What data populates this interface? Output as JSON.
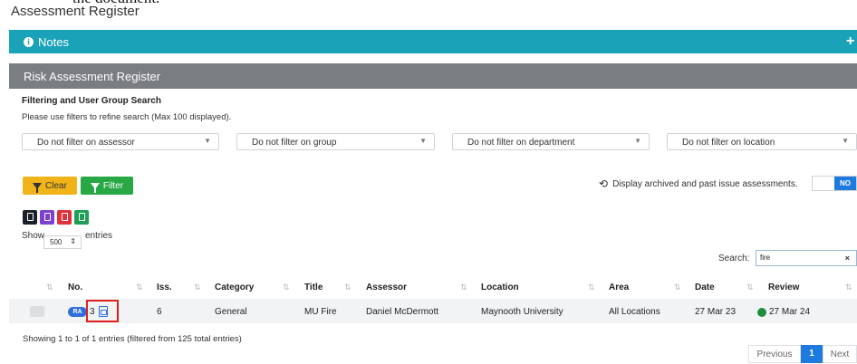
{
  "page": {
    "top_fragment": "the document.",
    "title": "Assessment Register"
  },
  "notes": {
    "label": "Notes"
  },
  "register": {
    "title": "Risk Assessment Register",
    "filter_heading": "Filtering and User Group Search",
    "filter_hint": "Please use filters to refine search (Max 100 displayed).",
    "filters": [
      {
        "label": "Do not filter on assessor"
      },
      {
        "label": "Do not filter on group"
      },
      {
        "label": "Do not filter on department"
      },
      {
        "label": "Do not filter on location"
      }
    ],
    "clear_label": "Clear",
    "filter_label": "Filter",
    "archive_text": "Display archived and past issue assessments.",
    "archive_toggle": "NO",
    "export_colors": [
      "#1c1f2b",
      "#7b3fd1",
      "#e0323a",
      "#1e9e57"
    ]
  },
  "table_controls": {
    "show_label": "Show",
    "length_value": "500",
    "entries_label": "entries",
    "search_label": "Search:",
    "search_value": "fire"
  },
  "table": {
    "columns": [
      "No.",
      "Iss.",
      "Category",
      "Title",
      "Assessor",
      "Location",
      "Area",
      "Date",
      "Review"
    ],
    "rows": [
      {
        "badge": "RA",
        "no": "3",
        "iss": "6",
        "category": "General",
        "title": "MU Fire",
        "assessor": "Daniel McDermott",
        "location": "Maynooth University",
        "area": "All Locations",
        "date": "27 Mar 23",
        "review": "27 Mar 24"
      }
    ]
  },
  "footer": {
    "info": "Showing 1 to 1 of 1 entries (filtered from 125 total entries)",
    "prev": "Previous",
    "page": "1",
    "next": "Next"
  }
}
